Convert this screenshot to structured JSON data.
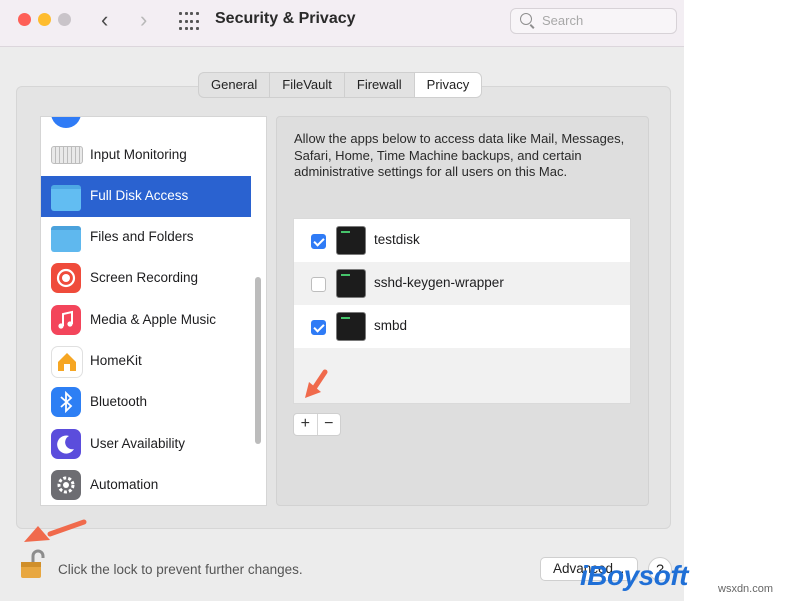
{
  "window": {
    "title": "Security & Privacy",
    "search_placeholder": "Search"
  },
  "tabs": [
    {
      "label": "General",
      "active": false
    },
    {
      "label": "FileVault",
      "active": false
    },
    {
      "label": "Firewall",
      "active": false
    },
    {
      "label": "Privacy",
      "active": true
    }
  ],
  "sidebar": {
    "items": [
      {
        "label": "Input Monitoring",
        "icon": "keyboard-icon",
        "selected": false
      },
      {
        "label": "Full Disk Access",
        "icon": "folder-icon",
        "selected": true
      },
      {
        "label": "Files and Folders",
        "icon": "folder-icon",
        "selected": false
      },
      {
        "label": "Screen Recording",
        "icon": "record-icon",
        "selected": false
      },
      {
        "label": "Media & Apple Music",
        "icon": "music-note-icon",
        "selected": false
      },
      {
        "label": "HomeKit",
        "icon": "home-icon",
        "selected": false
      },
      {
        "label": "Bluetooth",
        "icon": "bluetooth-icon",
        "selected": false
      },
      {
        "label": "User Availability",
        "icon": "moon-icon",
        "selected": false
      },
      {
        "label": "Automation",
        "icon": "gear-icon",
        "selected": false
      }
    ]
  },
  "detail": {
    "description": "Allow the apps below to access data like Mail, Messages, Safari, Home, Time Machine backups, and certain administrative settings for all users on this Mac.",
    "apps": [
      {
        "name": "testdisk",
        "checked": true
      },
      {
        "name": "sshd-keygen-wrapper",
        "checked": false
      },
      {
        "name": "smbd",
        "checked": true
      }
    ],
    "add_label": "+",
    "remove_label": "−"
  },
  "footer": {
    "lock_text": "Click the lock to prevent further changes.",
    "advanced_label": "Advanced...",
    "help_label": "?"
  },
  "watermark": {
    "brand": "iBoysoft",
    "domain": "wsxdn.com"
  },
  "colors": {
    "selection": "#2a62d0",
    "checkbox_on": "#2f7bf6",
    "annotation_arrow": "#f06a4c",
    "watermark": "#1f6fd6"
  }
}
